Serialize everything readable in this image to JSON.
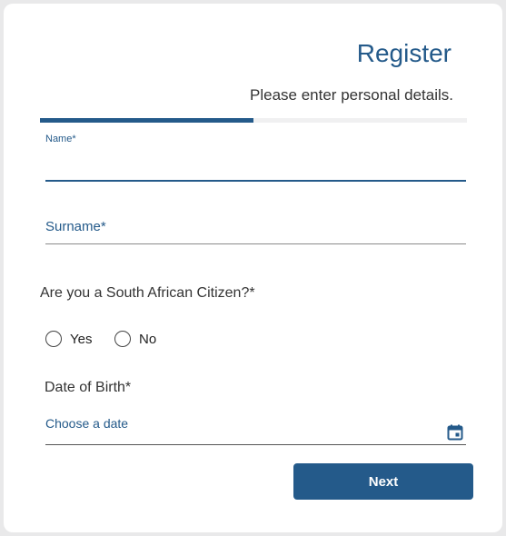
{
  "header": {
    "title": "Register",
    "subtitle": "Please enter personal details."
  },
  "progress": {
    "fraction": 0.5
  },
  "form": {
    "name": {
      "label": "Name*",
      "value": ""
    },
    "surname": {
      "placeholder": "Surname*",
      "value": ""
    },
    "citizen": {
      "question": "Are you a South African Citizen?*",
      "options": [
        "Yes",
        "No"
      ],
      "selected": null
    },
    "dob": {
      "label": "Date of Birth*",
      "placeholder": "Choose a date",
      "icon": "calendar-icon"
    }
  },
  "actions": {
    "next_label": "Next"
  },
  "colors": {
    "accent": "#245a8a",
    "background": "#e9e9ea",
    "card": "#ffffff"
  }
}
